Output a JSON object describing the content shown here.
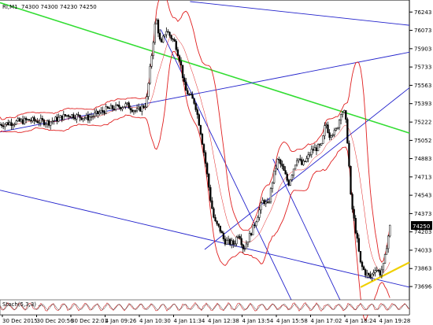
{
  "chart_data": {
    "type": "candlestick",
    "header": {
      "symbol_timeframe": "RI,M1",
      "ohlc": "74300 74300 74230 74250"
    },
    "price_axis": {
      "ticks": [
        76243,
        76073,
        75903,
        75733,
        75563,
        75393,
        75222,
        75052,
        74883,
        74713,
        74543,
        74373,
        74203,
        74033,
        73863,
        73696
      ],
      "ylim": [
        73580,
        76340
      ],
      "current_price": "74250"
    },
    "time_axis": {
      "labels": [
        "30 Dec 2015",
        "30 Dec 20:56",
        "30 Dec 22:01",
        "4 Jan 09:26",
        "4 Jan 10:30",
        "4 Jan 11:34",
        "4 Jan 12:38",
        "4 Jan 13:54",
        "4 Jan 15:58",
        "4 Jan 17:02",
        "4 Jan 18:24",
        "4 Jan 19:28"
      ]
    },
    "price_series": [
      [
        0,
        75200
      ],
      [
        3,
        75240
      ],
      [
        5,
        75220
      ],
      [
        7,
        75290
      ],
      [
        9,
        75260
      ],
      [
        11,
        75340
      ],
      [
        13,
        75380
      ],
      [
        14,
        75320
      ],
      [
        15,
        75390
      ],
      [
        16,
        76200
      ],
      [
        16.5,
        75920
      ],
      [
        17,
        76080
      ],
      [
        18,
        75950
      ],
      [
        18.5,
        75780
      ],
      [
        19,
        75520
      ],
      [
        20,
        75400
      ],
      [
        20.5,
        75180
      ],
      [
        21,
        74900
      ],
      [
        21.6,
        74500
      ],
      [
        22,
        74300
      ],
      [
        22.6,
        74220
      ],
      [
        23,
        74120
      ],
      [
        24,
        74090
      ],
      [
        24.5,
        74200
      ],
      [
        25,
        74040
      ],
      [
        26,
        74250
      ],
      [
        27,
        74500
      ],
      [
        27.5,
        74440
      ],
      [
        28,
        74700
      ],
      [
        28.5,
        74880
      ],
      [
        29,
        74790
      ],
      [
        29.6,
        74650
      ],
      [
        30,
        74760
      ],
      [
        30.5,
        74900
      ],
      [
        31,
        74820
      ],
      [
        31.5,
        74880
      ],
      [
        32,
        74960
      ],
      [
        33,
        75000
      ],
      [
        33.4,
        75220
      ],
      [
        33.8,
        75100
      ],
      [
        34,
        75130
      ],
      [
        34.4,
        75120
      ],
      [
        34.8,
        75240
      ],
      [
        35,
        75330
      ],
      [
        35.4,
        75300
      ],
      [
        35.7,
        75000
      ],
      [
        36,
        74500
      ],
      [
        36.6,
        74150
      ],
      [
        37,
        73900
      ],
      [
        37.5,
        73820
      ],
      [
        38,
        73780
      ],
      [
        38.5,
        73870
      ],
      [
        39,
        73820
      ],
      [
        39.4,
        73900
      ],
      [
        39.7,
        74100
      ],
      [
        40,
        74250
      ]
    ],
    "annotation": "Stoch(5,3,3) ..."
  }
}
